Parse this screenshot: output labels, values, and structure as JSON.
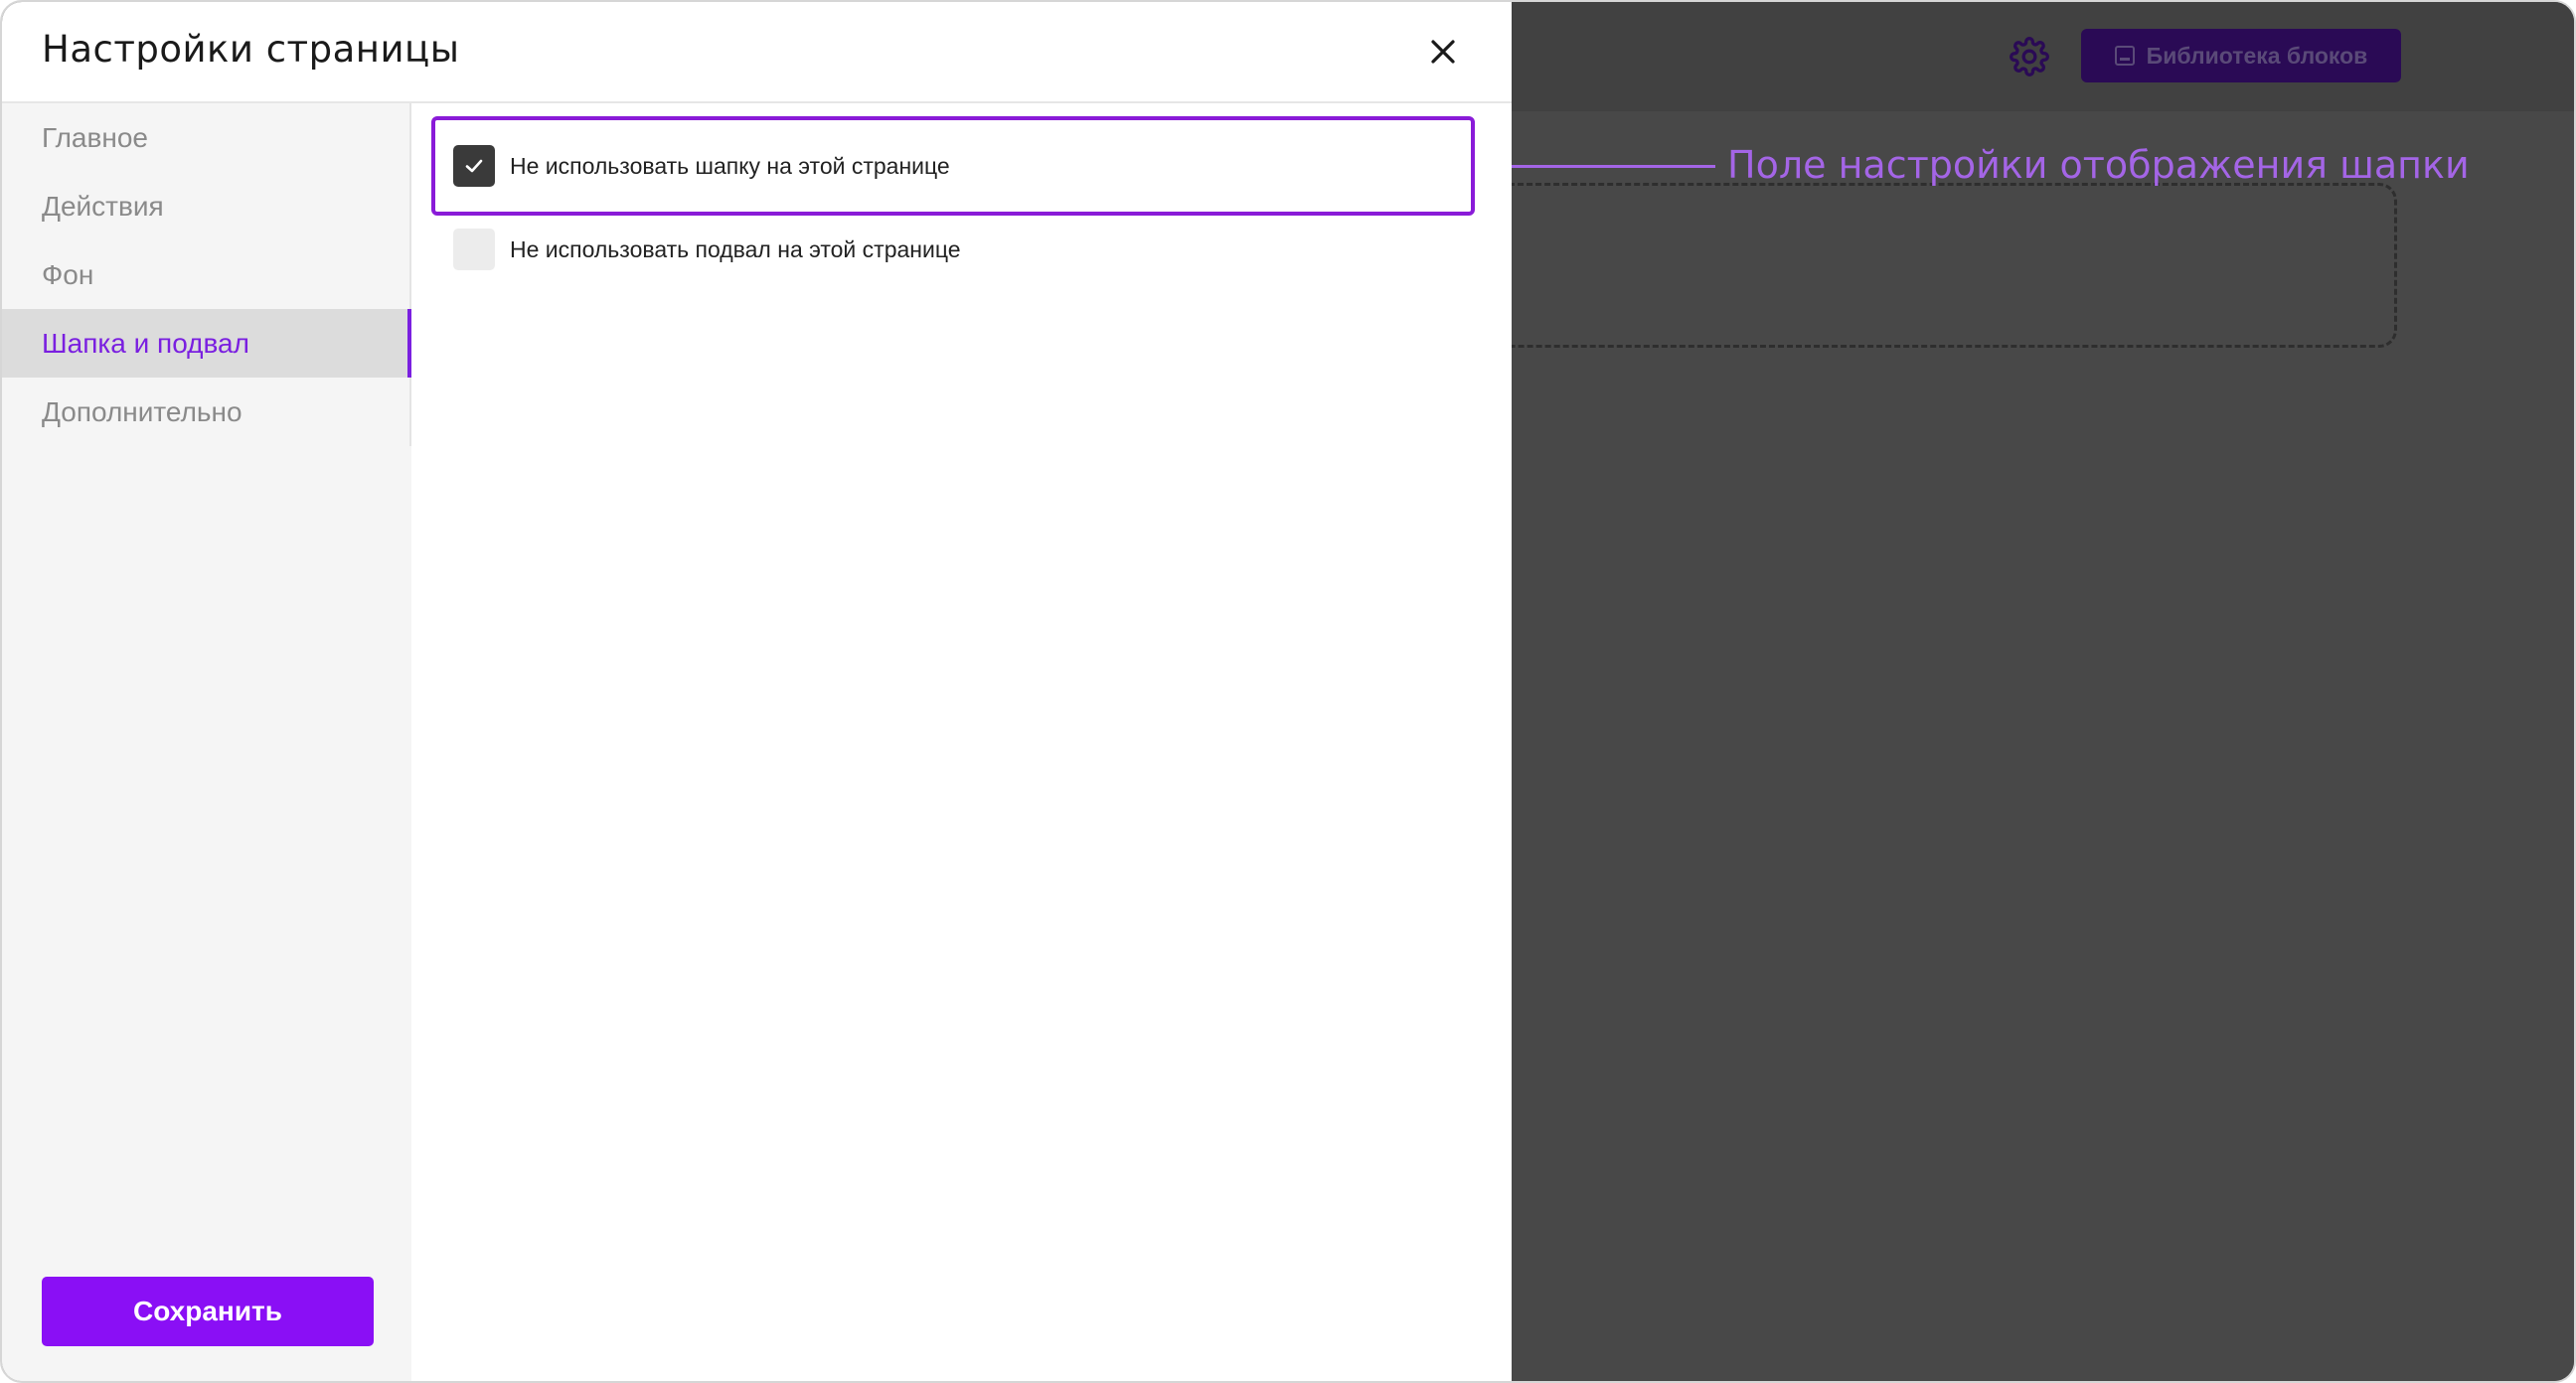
{
  "modal": {
    "title": "Настройки страницы",
    "close_icon": "close-icon"
  },
  "sidebar": {
    "items": [
      {
        "label": "Главное",
        "active": false
      },
      {
        "label": "Действия",
        "active": false
      },
      {
        "label": "Фон",
        "active": false
      },
      {
        "label": "Шапка и подвал",
        "active": true
      },
      {
        "label": "Дополнительно",
        "active": false
      }
    ],
    "save_label": "Сохранить"
  },
  "options": [
    {
      "label": "Не использовать шапку на этой странице",
      "checked": true
    },
    {
      "label": "Не использовать подвал на этой странице",
      "checked": false
    }
  ],
  "editor": {
    "settings_icon": "gear-icon",
    "library_button_label": "Библиотека блоков"
  },
  "annotation": {
    "text": "Поле настройки отображения шапки"
  },
  "colors": {
    "accent": "#8a0ff5",
    "active_text": "#7a1fe0",
    "annotation": "#a465e6",
    "overlay": "#484848",
    "checkbox_checked": "#3a3a3a"
  }
}
